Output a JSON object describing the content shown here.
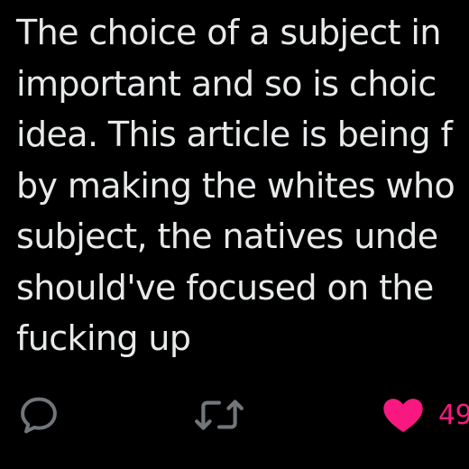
{
  "tweet": {
    "text_lines": [
      "The choice of a subject in",
      "important and so is choic",
      "idea. This article is being f",
      "by making the whites who",
      "subject, the natives unde",
      "should've focused on the",
      "fucking up"
    ]
  },
  "actions": {
    "reply": {
      "icon": "reply-icon"
    },
    "retweet": {
      "icon": "retweet-icon"
    },
    "like": {
      "icon": "heart-icon",
      "count": "49",
      "state": "liked"
    }
  },
  "colors": {
    "background": "#000000",
    "text": "#e7e9ea",
    "icon_muted": "#71767b",
    "like_active": "#f91880"
  }
}
